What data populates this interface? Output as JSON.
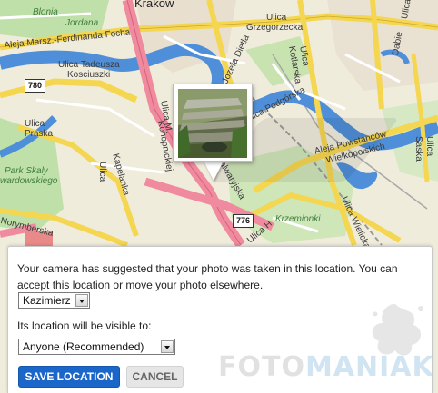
{
  "map": {
    "city_label": "Krakow",
    "labels": {
      "blonia": "Blonia",
      "jordana": "Jordana",
      "focha": "Aleja Marsz.-Ferdinanda Focha",
      "tadeusza_1": "Ulica Tadeusza",
      "tadeusza_2": "Kosciuszki",
      "praska_1": "Ulica",
      "praska_2": "Praska",
      "park_1": "Park Skaly",
      "park_2": "wardowskiego",
      "norymberska": "Norymberska",
      "kapelanka_1": "Ulica",
      "kapelanka_2": "Kapelanka",
      "konopnickiej_1": "Ulica M.",
      "konopnickiej_2": "Konopnickiej",
      "kalwaryjska": "Kalwaryjska",
      "grzegorzecka_1": "Ulica",
      "grzegorzecka_2": "Grzegorzecka",
      "dietla": "Ulica Jozefa Dietla",
      "kotlarska_1": "Ulica",
      "kotlarska_2": "Kotlarska",
      "podgorska": "Ulica Podgórska",
      "powstancow_1": "Aleja Powstanców",
      "powstancow_2": "Wielkopolskich",
      "krzemionki": "Krzemionki",
      "wielicka": "Ulica Wielicka",
      "dabie_1": "Ulica",
      "dabie_2": "Dabie",
      "saska_1": "Ulica",
      "saska_2": "Saska",
      "ulica_h": "Ulica H"
    },
    "shields": {
      "r780": "780",
      "r776": "776"
    }
  },
  "panel": {
    "message": "Your camera has suggested that your photo was taken in this location. You can accept this location or move your photo elsewhere.",
    "place_selected": "Kazimierz",
    "visibility_label": "Its location will be visible to:",
    "visibility_selected": "Anyone (Recommended)",
    "save_label": "SAVE LOCATION",
    "cancel_label": "CANCEL"
  },
  "watermark": {
    "part1": "FOTO",
    "part2": "MANIAK"
  },
  "colors": {
    "primary_button": "#1b66c9",
    "river": "#4f8fd9",
    "park": "#bfe0a8",
    "main_road": "#f08a9e",
    "road": "#f5d650"
  }
}
